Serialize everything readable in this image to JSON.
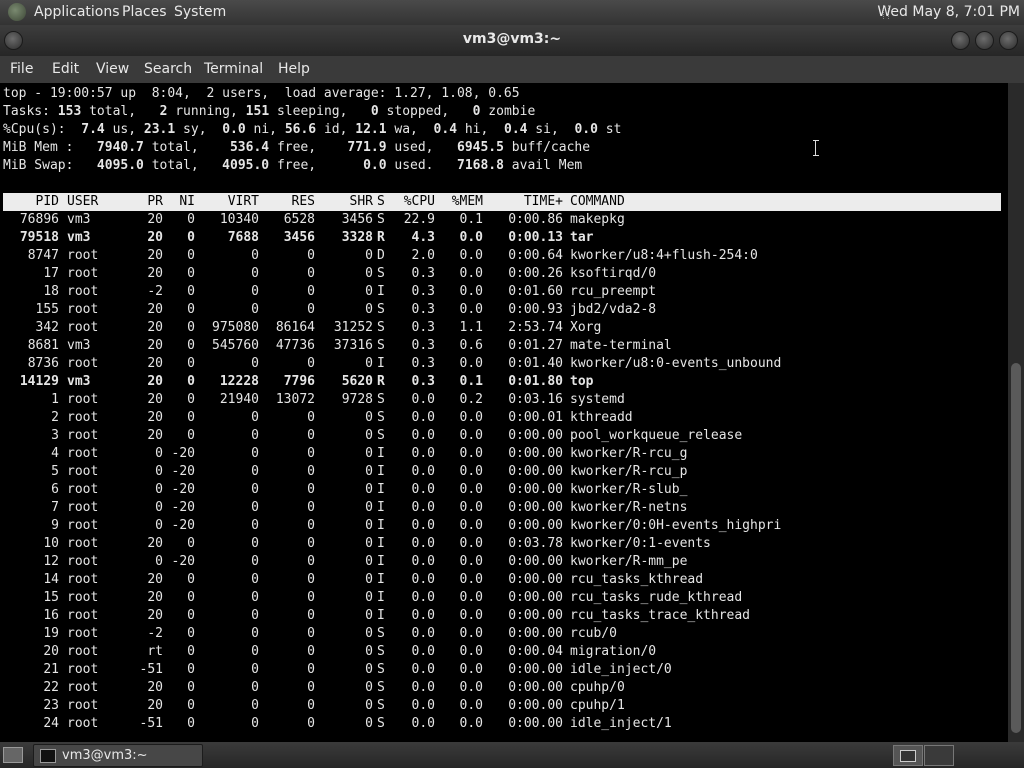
{
  "top_panel": {
    "menus": [
      "Applications",
      "Places",
      "System"
    ],
    "clock": "Wed May 8, 7:01 PM"
  },
  "window": {
    "title": "vm3@vm3:~"
  },
  "menubar": [
    "File",
    "Edit",
    "View",
    "Search",
    "Terminal",
    "Help"
  ],
  "terminal": {
    "summary_lines": [
      [
        {
          "t": "top - 19:00:57 up  8:04,  2 users,  load average: 1.27, 1.08, 0.65"
        }
      ],
      [
        {
          "t": "Tasks: "
        },
        {
          "t": "153",
          "b": true
        },
        {
          "t": " total,   "
        },
        {
          "t": "2",
          "b": true
        },
        {
          "t": " running, "
        },
        {
          "t": "151",
          "b": true
        },
        {
          "t": " sleeping,   "
        },
        {
          "t": "0",
          "b": true
        },
        {
          "t": " stopped,   "
        },
        {
          "t": "0",
          "b": true
        },
        {
          "t": " zombie"
        }
      ],
      [
        {
          "t": "%Cpu(s):  "
        },
        {
          "t": "7.4",
          "b": true
        },
        {
          "t": " us, "
        },
        {
          "t": "23.1",
          "b": true
        },
        {
          "t": " sy,  "
        },
        {
          "t": "0.0",
          "b": true
        },
        {
          "t": " ni, "
        },
        {
          "t": "56.6",
          "b": true
        },
        {
          "t": " id, "
        },
        {
          "t": "12.1",
          "b": true
        },
        {
          "t": " wa,  "
        },
        {
          "t": "0.4",
          "b": true
        },
        {
          "t": " hi,  "
        },
        {
          "t": "0.4",
          "b": true
        },
        {
          "t": " si,  "
        },
        {
          "t": "0.0",
          "b": true
        },
        {
          "t": " st"
        }
      ],
      [
        {
          "t": "MiB Mem :   "
        },
        {
          "t": "7940.7",
          "b": true
        },
        {
          "t": " total,    "
        },
        {
          "t": "536.4",
          "b": true
        },
        {
          "t": " free,    "
        },
        {
          "t": "771.9",
          "b": true
        },
        {
          "t": " used,   "
        },
        {
          "t": "6945.5",
          "b": true
        },
        {
          "t": " buff/cache"
        }
      ],
      [
        {
          "t": "MiB Swap:   "
        },
        {
          "t": "4095.0",
          "b": true
        },
        {
          "t": " total,   "
        },
        {
          "t": "4095.0",
          "b": true
        },
        {
          "t": " free,      "
        },
        {
          "t": "0.0",
          "b": true
        },
        {
          "t": " used.   "
        },
        {
          "t": "7168.8",
          "b": true
        },
        {
          "t": " avail Mem"
        }
      ]
    ],
    "columns": [
      "PID",
      "USER",
      "PR",
      "NI",
      "VIRT",
      "RES",
      "SHR",
      "S",
      "%CPU",
      "%MEM",
      "TIME+",
      "COMMAND"
    ],
    "processes": [
      {
        "pid": "76896",
        "user": "vm3",
        "pr": "20",
        "ni": "0",
        "virt": "10340",
        "res": "6528",
        "shr": "3456",
        "s": "S",
        "cpu": "22.9",
        "mem": "0.1",
        "time": "0:00.86",
        "cmd": "makepkg",
        "bold": false
      },
      {
        "pid": "79518",
        "user": "vm3",
        "pr": "20",
        "ni": "0",
        "virt": "7688",
        "res": "3456",
        "shr": "3328",
        "s": "R",
        "cpu": "4.3",
        "mem": "0.0",
        "time": "0:00.13",
        "cmd": "tar",
        "bold": true
      },
      {
        "pid": "8747",
        "user": "root",
        "pr": "20",
        "ni": "0",
        "virt": "0",
        "res": "0",
        "shr": "0",
        "s": "D",
        "cpu": "2.0",
        "mem": "0.0",
        "time": "0:00.64",
        "cmd": "kworker/u8:4+flush-254:0",
        "bold": false
      },
      {
        "pid": "17",
        "user": "root",
        "pr": "20",
        "ni": "0",
        "virt": "0",
        "res": "0",
        "shr": "0",
        "s": "S",
        "cpu": "0.3",
        "mem": "0.0",
        "time": "0:00.26",
        "cmd": "ksoftirqd/0",
        "bold": false
      },
      {
        "pid": "18",
        "user": "root",
        "pr": "-2",
        "ni": "0",
        "virt": "0",
        "res": "0",
        "shr": "0",
        "s": "I",
        "cpu": "0.3",
        "mem": "0.0",
        "time": "0:01.60",
        "cmd": "rcu_preempt",
        "bold": false
      },
      {
        "pid": "155",
        "user": "root",
        "pr": "20",
        "ni": "0",
        "virt": "0",
        "res": "0",
        "shr": "0",
        "s": "S",
        "cpu": "0.3",
        "mem": "0.0",
        "time": "0:00.93",
        "cmd": "jbd2/vda2-8",
        "bold": false
      },
      {
        "pid": "342",
        "user": "root",
        "pr": "20",
        "ni": "0",
        "virt": "975080",
        "res": "86164",
        "shr": "31252",
        "s": "S",
        "cpu": "0.3",
        "mem": "1.1",
        "time": "2:53.74",
        "cmd": "Xorg",
        "bold": false
      },
      {
        "pid": "8681",
        "user": "vm3",
        "pr": "20",
        "ni": "0",
        "virt": "545760",
        "res": "47736",
        "shr": "37316",
        "s": "S",
        "cpu": "0.3",
        "mem": "0.6",
        "time": "0:01.27",
        "cmd": "mate-terminal",
        "bold": false
      },
      {
        "pid": "8736",
        "user": "root",
        "pr": "20",
        "ni": "0",
        "virt": "0",
        "res": "0",
        "shr": "0",
        "s": "I",
        "cpu": "0.3",
        "mem": "0.0",
        "time": "0:01.40",
        "cmd": "kworker/u8:0-events_unbound",
        "bold": false
      },
      {
        "pid": "14129",
        "user": "vm3",
        "pr": "20",
        "ni": "0",
        "virt": "12228",
        "res": "7796",
        "shr": "5620",
        "s": "R",
        "cpu": "0.3",
        "mem": "0.1",
        "time": "0:01.80",
        "cmd": "top",
        "bold": true
      },
      {
        "pid": "1",
        "user": "root",
        "pr": "20",
        "ni": "0",
        "virt": "21940",
        "res": "13072",
        "shr": "9728",
        "s": "S",
        "cpu": "0.0",
        "mem": "0.2",
        "time": "0:03.16",
        "cmd": "systemd",
        "bold": false
      },
      {
        "pid": "2",
        "user": "root",
        "pr": "20",
        "ni": "0",
        "virt": "0",
        "res": "0",
        "shr": "0",
        "s": "S",
        "cpu": "0.0",
        "mem": "0.0",
        "time": "0:00.01",
        "cmd": "kthreadd",
        "bold": false
      },
      {
        "pid": "3",
        "user": "root",
        "pr": "20",
        "ni": "0",
        "virt": "0",
        "res": "0",
        "shr": "0",
        "s": "S",
        "cpu": "0.0",
        "mem": "0.0",
        "time": "0:00.00",
        "cmd": "pool_workqueue_release",
        "bold": false
      },
      {
        "pid": "4",
        "user": "root",
        "pr": "0",
        "ni": "-20",
        "virt": "0",
        "res": "0",
        "shr": "0",
        "s": "I",
        "cpu": "0.0",
        "mem": "0.0",
        "time": "0:00.00",
        "cmd": "kworker/R-rcu_g",
        "bold": false
      },
      {
        "pid": "5",
        "user": "root",
        "pr": "0",
        "ni": "-20",
        "virt": "0",
        "res": "0",
        "shr": "0",
        "s": "I",
        "cpu": "0.0",
        "mem": "0.0",
        "time": "0:00.00",
        "cmd": "kworker/R-rcu_p",
        "bold": false
      },
      {
        "pid": "6",
        "user": "root",
        "pr": "0",
        "ni": "-20",
        "virt": "0",
        "res": "0",
        "shr": "0",
        "s": "I",
        "cpu": "0.0",
        "mem": "0.0",
        "time": "0:00.00",
        "cmd": "kworker/R-slub_",
        "bold": false
      },
      {
        "pid": "7",
        "user": "root",
        "pr": "0",
        "ni": "-20",
        "virt": "0",
        "res": "0",
        "shr": "0",
        "s": "I",
        "cpu": "0.0",
        "mem": "0.0",
        "time": "0:00.00",
        "cmd": "kworker/R-netns",
        "bold": false
      },
      {
        "pid": "9",
        "user": "root",
        "pr": "0",
        "ni": "-20",
        "virt": "0",
        "res": "0",
        "shr": "0",
        "s": "I",
        "cpu": "0.0",
        "mem": "0.0",
        "time": "0:00.00",
        "cmd": "kworker/0:0H-events_highpri",
        "bold": false
      },
      {
        "pid": "10",
        "user": "root",
        "pr": "20",
        "ni": "0",
        "virt": "0",
        "res": "0",
        "shr": "0",
        "s": "I",
        "cpu": "0.0",
        "mem": "0.0",
        "time": "0:03.78",
        "cmd": "kworker/0:1-events",
        "bold": false
      },
      {
        "pid": "12",
        "user": "root",
        "pr": "0",
        "ni": "-20",
        "virt": "0",
        "res": "0",
        "shr": "0",
        "s": "I",
        "cpu": "0.0",
        "mem": "0.0",
        "time": "0:00.00",
        "cmd": "kworker/R-mm_pe",
        "bold": false
      },
      {
        "pid": "14",
        "user": "root",
        "pr": "20",
        "ni": "0",
        "virt": "0",
        "res": "0",
        "shr": "0",
        "s": "I",
        "cpu": "0.0",
        "mem": "0.0",
        "time": "0:00.00",
        "cmd": "rcu_tasks_kthread",
        "bold": false
      },
      {
        "pid": "15",
        "user": "root",
        "pr": "20",
        "ni": "0",
        "virt": "0",
        "res": "0",
        "shr": "0",
        "s": "I",
        "cpu": "0.0",
        "mem": "0.0",
        "time": "0:00.00",
        "cmd": "rcu_tasks_rude_kthread",
        "bold": false
      },
      {
        "pid": "16",
        "user": "root",
        "pr": "20",
        "ni": "0",
        "virt": "0",
        "res": "0",
        "shr": "0",
        "s": "I",
        "cpu": "0.0",
        "mem": "0.0",
        "time": "0:00.00",
        "cmd": "rcu_tasks_trace_kthread",
        "bold": false
      },
      {
        "pid": "19",
        "user": "root",
        "pr": "-2",
        "ni": "0",
        "virt": "0",
        "res": "0",
        "shr": "0",
        "s": "S",
        "cpu": "0.0",
        "mem": "0.0",
        "time": "0:00.00",
        "cmd": "rcub/0",
        "bold": false
      },
      {
        "pid": "20",
        "user": "root",
        "pr": "rt",
        "ni": "0",
        "virt": "0",
        "res": "0",
        "shr": "0",
        "s": "S",
        "cpu": "0.0",
        "mem": "0.0",
        "time": "0:00.04",
        "cmd": "migration/0",
        "bold": false
      },
      {
        "pid": "21",
        "user": "root",
        "pr": "-51",
        "ni": "0",
        "virt": "0",
        "res": "0",
        "shr": "0",
        "s": "S",
        "cpu": "0.0",
        "mem": "0.0",
        "time": "0:00.00",
        "cmd": "idle_inject/0",
        "bold": false
      },
      {
        "pid": "22",
        "user": "root",
        "pr": "20",
        "ni": "0",
        "virt": "0",
        "res": "0",
        "shr": "0",
        "s": "S",
        "cpu": "0.0",
        "mem": "0.0",
        "time": "0:00.00",
        "cmd": "cpuhp/0",
        "bold": false
      },
      {
        "pid": "23",
        "user": "root",
        "pr": "20",
        "ni": "0",
        "virt": "0",
        "res": "0",
        "shr": "0",
        "s": "S",
        "cpu": "0.0",
        "mem": "0.0",
        "time": "0:00.00",
        "cmd": "cpuhp/1",
        "bold": false
      },
      {
        "pid": "24",
        "user": "root",
        "pr": "-51",
        "ni": "0",
        "virt": "0",
        "res": "0",
        "shr": "0",
        "s": "S",
        "cpu": "0.0",
        "mem": "0.0",
        "time": "0:00.00",
        "cmd": "idle_inject/1",
        "bold": false
      }
    ]
  },
  "taskbar": {
    "task_label": "vm3@vm3:~"
  },
  "colors": {
    "terminal_bg": "#000000",
    "terminal_fg": "#e6e6e6",
    "header_bg": "#ececec",
    "panel_bg": "#3a3a3a"
  }
}
